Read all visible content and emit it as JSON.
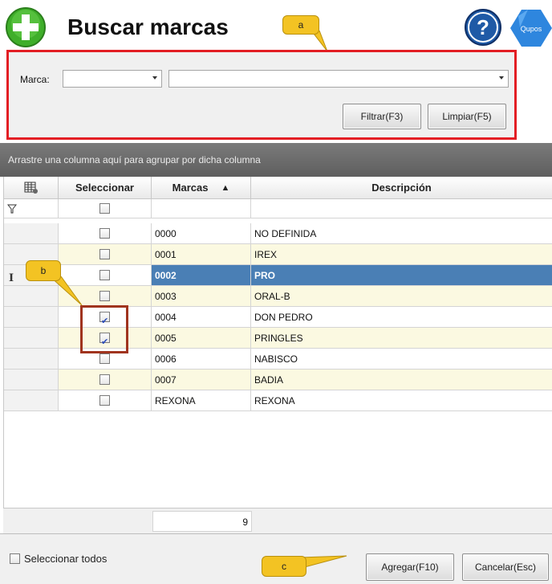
{
  "header": {
    "title": "Buscar marcas",
    "add_icon": "plus-circle-icon",
    "help_icon": "question-circle-icon",
    "logo_text": "Qupos"
  },
  "callouts": {
    "a": "a",
    "b": "b",
    "c": "c"
  },
  "filter": {
    "marca_label": "Marca:",
    "code_combo_value": "",
    "description_combo_value": "",
    "filter_button": "Filtrar(F3)",
    "clear_button": "Limpiar(F5)"
  },
  "group_bar": {
    "hint": "Arrastre una columna aquí para agrupar por dicha columna"
  },
  "grid": {
    "columns": {
      "seleccionar": "Seleccionar",
      "marcas": "Marcas",
      "marcas_sort": "▲",
      "descripcion": "Descripción"
    },
    "column_chooser_icon": "table-settings-icon",
    "filter_row_icon": "filter-icon",
    "rows": [
      {
        "code": "0000",
        "description": "NO DEFINIDA",
        "checked": false
      },
      {
        "code": "0001",
        "description": "IREX",
        "checked": false
      },
      {
        "code": "0002",
        "description": "PRO",
        "checked": false,
        "selected": true
      },
      {
        "code": "0003",
        "description": "ORAL-B",
        "checked": false
      },
      {
        "code": "0004",
        "description": "DON PEDRO",
        "checked": true
      },
      {
        "code": "0005",
        "description": "PRINGLES",
        "checked": true
      },
      {
        "code": "0006",
        "description": "NABISCO",
        "checked": false
      },
      {
        "code": "0007",
        "description": "BADIA",
        "checked": false
      },
      {
        "code": "REXONA",
        "description": "REXONA",
        "checked": false
      }
    ],
    "row_count": "9"
  },
  "footer": {
    "select_all_label": "Seleccionar todos",
    "add_button": "Agregar(F10)",
    "cancel_button": "Cancelar(Esc)"
  },
  "colors": {
    "accent_red": "#e31e24",
    "callout_yellow": "#f3c323",
    "selected_row": "#4a7fb5",
    "alt_row": "#fbf9e1",
    "add_green": "#3fae2a",
    "help_blue": "#1f5aa6"
  }
}
